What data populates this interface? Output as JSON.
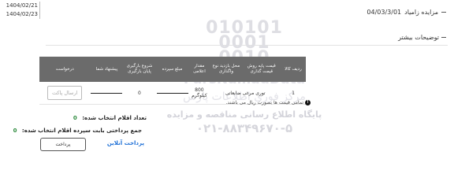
{
  "dates": {
    "start": "1404/02/21",
    "end": "1404/02/23"
  },
  "title": {
    "prefix": "مزایده زامیاد",
    "code": "04/03/3/01"
  },
  "more_description": {
    "label": "توضیحات بیشتر"
  },
  "watermark": {
    "numbers": [
      "010101",
      "0001",
      "0010"
    ],
    "brand": "ParsNamadData",
    "brand_fa": "مرکز فوری اطلاعات پارس",
    "tagline": "پایگاه اطلاع رسانی مناقصه و مزایده",
    "phone": "۰۲۱-۸۸۳۴۹۶۷۰-۵"
  },
  "table": {
    "headers": [
      "ردیف کالا",
      "قیمت پایه روش قیمت گذاری",
      "محل بازدید نوع واگذاری",
      "مقدار اعلامی",
      "مبلغ سپرده",
      "شروع بارگیری پایان بارگیری",
      "پیشنهاد شما",
      "درخواست"
    ],
    "rows": [
      {
        "row": "1",
        "item": "توری مرغی ضایعاتی",
        "amount": "800",
        "unit": "کیلوگرم",
        "deposit": "0",
        "request_label": "ارسال پاکت"
      }
    ]
  },
  "note": "تمامی قیمت ها بصورت ریال می باشند.",
  "summary": {
    "selected_count_label": "تعداد اقلام انتخاب شده:",
    "selected_count": "0",
    "deposit_total_label": "جمع پرداختی بابت سپرده اقلام انتخاب شده:",
    "deposit_total": "0"
  },
  "online_payment_label": "پرداخت آنلاین",
  "pay_button": "پرداخت"
}
